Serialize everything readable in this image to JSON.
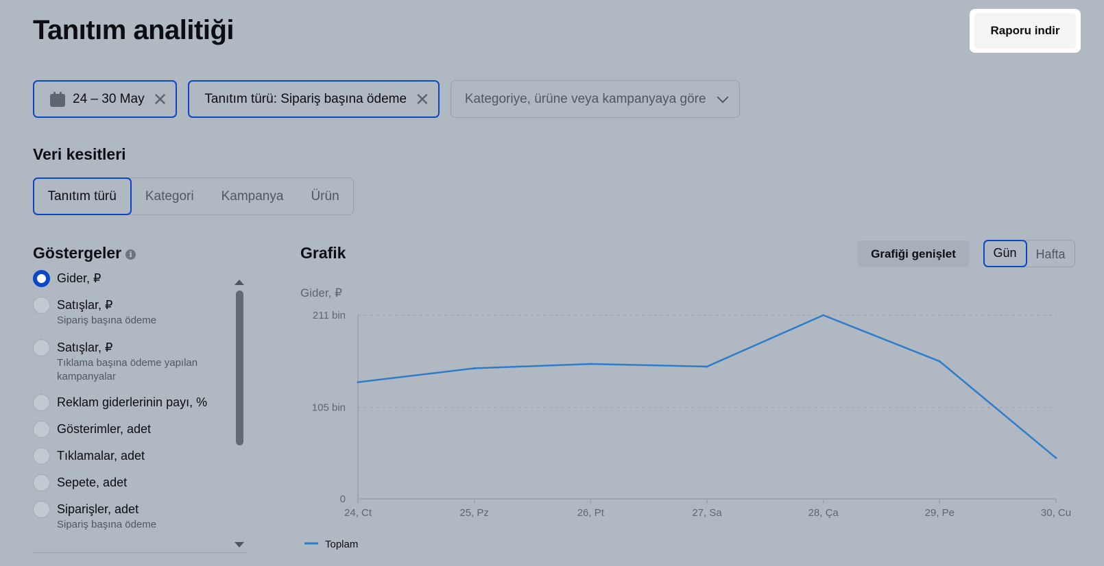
{
  "header": {
    "title": "Tanıtım analitiği",
    "download_label": "Raporu indir"
  },
  "filters": {
    "date": "24 – 30 May",
    "type": "Tanıtım türü: Sipariş başına ödeme",
    "category_placeholder": "Kategoriye, ürüne veya kampanyaya göre"
  },
  "slices": {
    "title": "Veri kesitleri",
    "tabs": [
      {
        "label": "Tanıtım türü",
        "active": true
      },
      {
        "label": "Kategori"
      },
      {
        "label": "Kampanya"
      },
      {
        "label": "Ürün"
      }
    ]
  },
  "indicators": {
    "title": "Göstergeler",
    "items": [
      {
        "label": "Gider, ₽",
        "selected": true
      },
      {
        "label": "Satışlar, ₽",
        "sub": "Sipariş başına ödeme"
      },
      {
        "label": "Satışlar, ₽",
        "sub": "Tıklama başına ödeme yapılan kampanyalar"
      },
      {
        "label": "Reklam giderlerinin payı, %"
      },
      {
        "label": "Gösterimler, adet"
      },
      {
        "label": "Tıklamalar, adet"
      },
      {
        "label": "Sepete, adet"
      },
      {
        "label": "Siparişler, adet",
        "sub": "Sipariş başına ödeme"
      }
    ]
  },
  "graph": {
    "title": "Grafik",
    "expand_label": "Grafiği genişlet",
    "period_day": "Gün",
    "period_week": "Hafta"
  },
  "chart_data": {
    "type": "line",
    "ylabel": "Gider, ₽",
    "x": [
      "24, Ct",
      "25, Pz",
      "26, Pt",
      "27, Sa",
      "28, Ça",
      "29, Pe",
      "30, Cu"
    ],
    "yticks": [
      {
        "value": 0,
        "label": "0"
      },
      {
        "value": 105,
        "label": "105 bin"
      },
      {
        "value": 211,
        "label": "211 bin"
      }
    ],
    "ylim": [
      0,
      211
    ],
    "series": [
      {
        "name": "Toplam",
        "color": "#2e7bcc",
        "values": [
          134,
          150,
          155,
          152,
          211,
          158,
          47
        ]
      }
    ],
    "grid": true,
    "legend": "bottom-left"
  }
}
